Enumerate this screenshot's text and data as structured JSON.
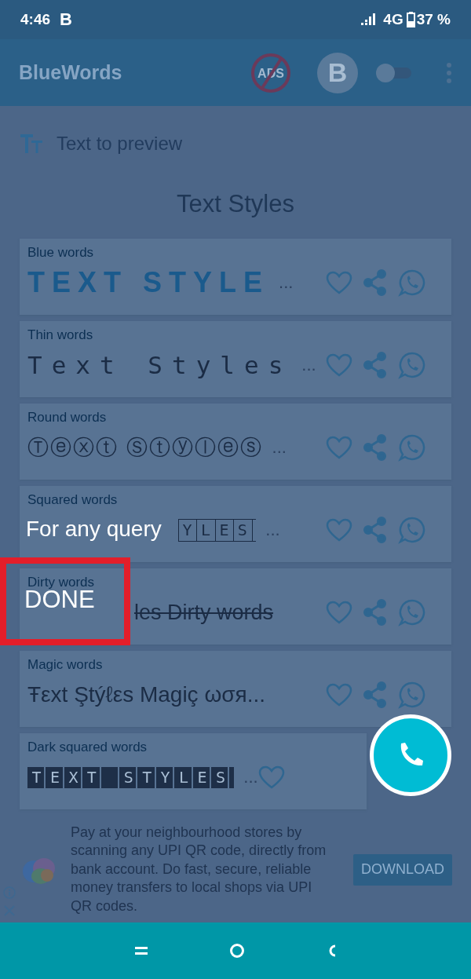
{
  "status_bar": {
    "time": "4:46",
    "notification": "B",
    "network": "4G",
    "battery": "37 %"
  },
  "app_bar": {
    "title": "BlueWords",
    "ads_badge": "ADS",
    "avatar": "B",
    "toggle": {
      "on": false
    }
  },
  "search": {
    "placeholder": "Text to preview"
  },
  "heading": "Text Styles",
  "styles": [
    {
      "label": "Blue words",
      "kind": "bold",
      "text": "TEXT STYLE",
      "more": "...",
      "share": true,
      "whatsapp": true
    },
    {
      "label": "Thin words",
      "kind": "thin",
      "text": "Text Styles",
      "more": "...",
      "share": true,
      "whatsapp": true
    },
    {
      "label": "Round words",
      "kind": "circled",
      "text": "Ⓣⓔⓧⓣ Ⓢⓣⓨⓛⓔⓢ",
      "more": "...",
      "share": true,
      "whatsapp": true
    },
    {
      "label": "Squared words",
      "kind": "boxed_covered",
      "text": "YLES",
      "more": "...",
      "share": true,
      "whatsapp": true
    },
    {
      "label": "Dirty words",
      "kind": "dirty_covered",
      "text": "les Dirty words",
      "share": true,
      "whatsapp": true
    },
    {
      "label": "Magic words",
      "kind": "plain",
      "text": "Ŧεxt Ştýℓεs Magiç ωσя...",
      "share": true,
      "whatsapp": true
    },
    {
      "label": "Dark squared words",
      "kind": "darkboxed",
      "text": "TEXT STYLES",
      "more": "...",
      "share": false,
      "whatsapp": false
    }
  ],
  "ad": {
    "text": "Pay at your neighbourhood stores by scanning any UPI QR code, directly from bank account. Do fast, secure, reliable money transfers to local shops via UPI QR codes.",
    "button": "DOWNLOAD"
  },
  "tooltip": {
    "message": "For any query",
    "action": "DONE"
  }
}
